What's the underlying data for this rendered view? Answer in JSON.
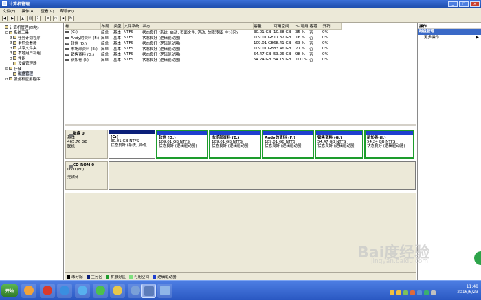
{
  "window": {
    "title": "计算机管理"
  },
  "menu": [
    "文件(F)",
    "操作(A)",
    "查看(V)",
    "帮助(H)"
  ],
  "toolbar_icons": [
    "back-icon",
    "forward-icon",
    "up-icon",
    "properties-icon",
    "help-icon",
    "delete-icon",
    "open-icon",
    "save-icon",
    "refresh-icon"
  ],
  "tree": [
    {
      "label": "计算机管理(本地)",
      "indent": 0,
      "expander": ""
    },
    {
      "label": "系统工具",
      "indent": 1,
      "expander": "-"
    },
    {
      "label": "任务计划程序",
      "indent": 2,
      "expander": "+"
    },
    {
      "label": "事件查看器",
      "indent": 2,
      "expander": "+"
    },
    {
      "label": "共享文件夹",
      "indent": 2,
      "expander": "+"
    },
    {
      "label": "本地用户和组",
      "indent": 2,
      "expander": "+"
    },
    {
      "label": "性能",
      "indent": 2,
      "expander": "+"
    },
    {
      "label": "设备管理器",
      "indent": 2,
      "expander": ""
    },
    {
      "label": "存储",
      "indent": 1,
      "expander": "-"
    },
    {
      "label": "磁盘管理",
      "indent": 2,
      "expander": "",
      "selected": true
    },
    {
      "label": "服务和应用程序",
      "indent": 1,
      "expander": "+"
    }
  ],
  "volume_table": {
    "headers": [
      "卷",
      "布局",
      "类型",
      "文件系统",
      "状态",
      "容量",
      "可用空间",
      "% 可用",
      "容错",
      "开销"
    ],
    "rows": [
      [
        "(C:)",
        "简单",
        "基本",
        "NTFS",
        "状态良好 (系统, 启动, 页面文件, 活动, 故障转储, 主分区)",
        "30.01 GB",
        "10.38 GB",
        "35 %",
        "否",
        "0%"
      ],
      [
        "Andy的资料 (F:)",
        "简单",
        "基本",
        "NTFS",
        "状态良好 (逻辑驱动器)",
        "109.01 GB",
        "17.32 GB",
        "16 %",
        "否",
        "0%"
      ],
      [
        "软件 (D:)",
        "简单",
        "基本",
        "NTFS",
        "状态良好 (逻辑驱动器)",
        "109.01 GB",
        "68.41 GB",
        "63 %",
        "否",
        "0%"
      ],
      [
        "市场部资料 (E:)",
        "简单",
        "基本",
        "NTFS",
        "状态良好 (逻辑驱动器)",
        "109.01 GB",
        "83.46 GB",
        "77 %",
        "否",
        "0%"
      ],
      [
        "销售资料 (G:)",
        "简单",
        "基本",
        "NTFS",
        "状态良好 (逻辑驱动器)",
        "54.47 GB",
        "53.26 GB",
        "98 %",
        "否",
        "0%"
      ],
      [
        "新加卷 (I:)",
        "简单",
        "基本",
        "NTFS",
        "状态良好 (逻辑驱动器)",
        "54.24 GB",
        "54.15 GB",
        "100 %",
        "否",
        "0%"
      ]
    ]
  },
  "disk0": {
    "name": "磁盘 0",
    "type": "基本",
    "size": "465.76 GB",
    "status": "联机",
    "partitions": [
      {
        "name": "(C:)",
        "size": "30.01 GB NTFS",
        "status": "状态良好 (系统, 启动,",
        "bar_color": "#0b1f7a",
        "grouped": false
      },
      {
        "name": "软件 (D:)",
        "size": "109.01 GB NTFS",
        "status": "状态良好 (逻辑驱动器)",
        "bar_color": "#1f3fcf",
        "grouped": true
      },
      {
        "name": "市场部资料 (E:)",
        "size": "109.01 GB NTFS",
        "status": "状态良好 (逻辑驱动器)",
        "bar_color": "#1f3fcf",
        "grouped": true
      },
      {
        "name": "Andy的资料 (F:)",
        "size": "109.01 GB NTFS",
        "status": "状态良好 (逻辑驱动器)",
        "bar_color": "#1f3fcf",
        "grouped": true
      },
      {
        "name": "销售资料 (G:)",
        "size": "54.47 GB NTFS",
        "status": "状态良好 (逻辑驱动器)",
        "bar_color": "#1f3fcf",
        "grouped": true
      },
      {
        "name": "新加卷 (I:)",
        "size": "54.24 GB NTFS",
        "status": "状态良好 (逻辑驱动器)",
        "bar_color": "#1f3fcf",
        "grouped": true
      }
    ]
  },
  "cdrom0": {
    "name": "CD-ROM 0",
    "type": "DVD (H:)",
    "status": "无媒体"
  },
  "legend": [
    {
      "label": "未分配",
      "color": "#000000"
    },
    {
      "label": "主分区",
      "color": "#0b1f7a"
    },
    {
      "label": "扩展分区",
      "color": "#1d9c2c"
    },
    {
      "label": "可用空间",
      "color": "#7ee07e"
    },
    {
      "label": "逻辑驱动器",
      "color": "#1f3fcf"
    }
  ],
  "actions": {
    "header": "操作",
    "section": "磁盘管理",
    "item": "更多操作",
    "item_arrow": "▶"
  },
  "taskbar": {
    "start": "开始",
    "clock_time": "11:48",
    "clock_date": "2016/6/23"
  },
  "watermark": {
    "brand": "Bai度经验",
    "url": "jingyan.baidu.com"
  }
}
